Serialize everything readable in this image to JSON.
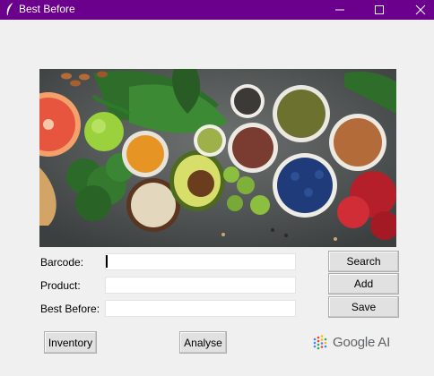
{
  "window": {
    "title": "Best Before",
    "minimize_glyph": "—",
    "maximize_glyph": "☐",
    "close_glyph": "✕"
  },
  "form": {
    "barcode": {
      "label": "Barcode:",
      "value": ""
    },
    "product": {
      "label": "Product:",
      "value": ""
    },
    "best_before": {
      "label": "Best Before:",
      "value": ""
    }
  },
  "buttons": {
    "search": "Search",
    "add": "Add",
    "save": "Save",
    "inventory": "Inventory",
    "analyse": "Analyse"
  },
  "branding": {
    "logo_text": "Google AI"
  },
  "colors": {
    "titlebar": "#6b008c",
    "window_background": "#f0f0f0",
    "button_face": "#e1e1e1"
  },
  "icons": {
    "app": "feather-icon",
    "hero": "vegetables-banner",
    "logo": "google-ai-dots-icon"
  }
}
